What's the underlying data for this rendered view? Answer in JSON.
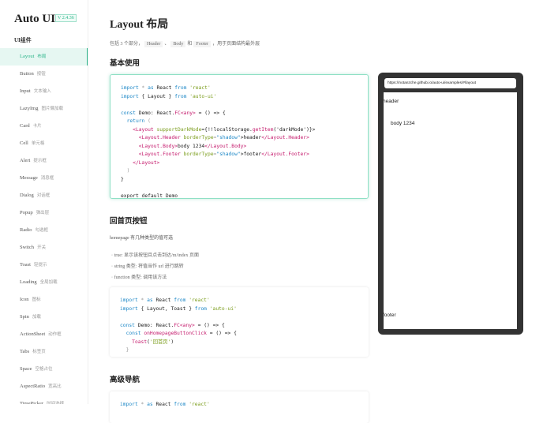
{
  "sidebar": {
    "logo": "Auto UI",
    "version": "V 2.4.36",
    "group": "UI组件",
    "items": [
      {
        "en": "Layout",
        "cn": "布局",
        "active": true
      },
      {
        "en": "Button",
        "cn": "按钮"
      },
      {
        "en": "Input",
        "cn": "文本输入"
      },
      {
        "en": "LazyImg",
        "cn": "图片懒加载"
      },
      {
        "en": "Card",
        "cn": "卡片"
      },
      {
        "en": "Cell",
        "cn": "单元格"
      },
      {
        "en": "Alert",
        "cn": "提示框"
      },
      {
        "en": "Message",
        "cn": "消息框"
      },
      {
        "en": "Dialog",
        "cn": "对话框"
      },
      {
        "en": "Popup",
        "cn": "弹出层"
      },
      {
        "en": "Radio",
        "cn": "勾选框"
      },
      {
        "en": "Switch",
        "cn": "开关"
      },
      {
        "en": "Toast",
        "cn": "轻提示"
      },
      {
        "en": "Loading",
        "cn": "全局加载"
      },
      {
        "en": "Icon",
        "cn": "图标"
      },
      {
        "en": "Spin",
        "cn": "加载"
      },
      {
        "en": "ActionSheet",
        "cn": "动作框"
      },
      {
        "en": "Tabs",
        "cn": "标签页"
      },
      {
        "en": "Space",
        "cn": "空格占位"
      },
      {
        "en": "AspectRatio",
        "cn": "宽高比"
      },
      {
        "en": "TimePicker",
        "cn": "时间选择"
      }
    ]
  },
  "main": {
    "title": "Layout 布局",
    "intro": {
      "pre": "包括 3 个部分，",
      "t1": "Header",
      "sep1": "、",
      "t2": "Body",
      "sep2": "和",
      "t3": "Footer",
      "post": "，用于页面结构最外层"
    },
    "h_basic": "基本使用",
    "code1": [
      [
        [
          "import",
          "k"
        ],
        [
          " * ",
          "p"
        ],
        [
          "as",
          "k"
        ],
        [
          " React ",
          ""
        ],
        [
          "from",
          "k"
        ],
        [
          " 'react'",
          "s"
        ]
      ],
      [
        [
          "import",
          "k"
        ],
        [
          " { Layout } ",
          ""
        ],
        [
          "from",
          "k"
        ],
        [
          " 'auto-ui'",
          "s"
        ]
      ],
      [],
      [
        [
          "const",
          "k"
        ],
        [
          " Demo: React.",
          ""
        ],
        [
          "FC",
          "t"
        ],
        [
          "<any>",
          "t"
        ],
        [
          " = () => {",
          ""
        ]
      ],
      [
        [
          "  return",
          "k"
        ],
        [
          " (",
          "p"
        ]
      ],
      [
        [
          "    <Layout ",
          "t"
        ],
        [
          "supportDarkMode",
          "s"
        ],
        [
          "={!!localStorage.",
          ""
        ],
        [
          "getItem",
          "t"
        ],
        [
          "('darkMode')}>",
          ""
        ]
      ],
      [
        [
          "      <Layout.Header ",
          "t"
        ],
        [
          "borderType",
          "s"
        ],
        [
          "=",
          "p"
        ],
        [
          "\"shadow\"",
          "k"
        ],
        [
          ">header",
          ""
        ],
        [
          "</Layout.Header>",
          "t"
        ]
      ],
      [
        [
          "      <Layout.Body>",
          "t"
        ],
        [
          "body 1234",
          ""
        ],
        [
          "</Layout.Body>",
          "t"
        ]
      ],
      [
        [
          "      <Layout.Footer ",
          "t"
        ],
        [
          "borderType",
          "s"
        ],
        [
          "=",
          "p"
        ],
        [
          "\"shadow\"",
          "k"
        ],
        [
          ">footer",
          ""
        ],
        [
          "</Layout.Footer>",
          "t"
        ]
      ],
      [
        [
          "    </Layout>",
          "t"
        ]
      ],
      [
        [
          "  )",
          "p"
        ]
      ],
      [
        [
          "}",
          ""
        ]
      ],
      [],
      [
        [
          "export default Demo",
          ""
        ]
      ]
    ],
    "h_home": "回首页按钮",
    "home_desc": "homepage 有几种类型的值可选",
    "home_list": [
      "true: 显示该按钮且点击到达/m/index 页面",
      "string 类型: 将值当作 url 进行跳转",
      "function 类型: 调用该方法"
    ],
    "code2": [
      [
        [
          "import",
          "k"
        ],
        [
          " * ",
          "p"
        ],
        [
          "as",
          "k"
        ],
        [
          " React ",
          ""
        ],
        [
          "from",
          "k"
        ],
        [
          " 'react'",
          "s"
        ]
      ],
      [
        [
          "import",
          "k"
        ],
        [
          " { Layout, Toast } ",
          ""
        ],
        [
          "from",
          "k"
        ],
        [
          " 'auto-ui'",
          "s"
        ]
      ],
      [],
      [
        [
          "const",
          "k"
        ],
        [
          " Demo: React.",
          ""
        ],
        [
          "FC",
          "t"
        ],
        [
          "<any>",
          "t"
        ],
        [
          " = () => {",
          ""
        ]
      ],
      [
        [
          "  const ",
          "k"
        ],
        [
          "onHomepageButtonClick",
          "t"
        ],
        [
          " = () => {",
          ""
        ]
      ],
      [
        [
          "    Toast",
          "t"
        ],
        [
          "(",
          ""
        ],
        [
          "'回首页'",
          "s"
        ],
        [
          ")",
          ""
        ]
      ],
      [
        [
          "  }",
          "p"
        ]
      ]
    ],
    "h_nav": "高级导航",
    "code3": [
      [
        [
          "import",
          "k"
        ],
        [
          " * ",
          "p"
        ],
        [
          "as",
          "k"
        ],
        [
          " React ",
          ""
        ],
        [
          "from",
          "k"
        ],
        [
          " 'react'",
          "s"
        ]
      ]
    ]
  },
  "preview": {
    "url": "https://notanzche.github.io/auto-ui/examples/#/layout",
    "header": "header",
    "body": "body 1234",
    "footer": "footer"
  }
}
